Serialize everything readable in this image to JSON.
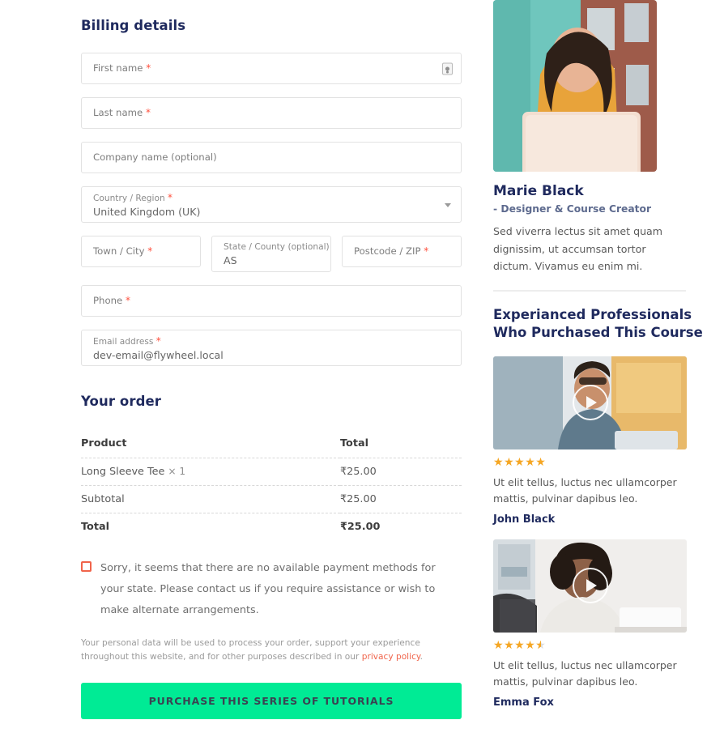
{
  "billing": {
    "title": "Billing details",
    "fields": [
      {
        "label": "First name",
        "required": true,
        "value": "",
        "icon": "autofill-contact-icon"
      },
      {
        "label": "Last name",
        "required": true,
        "value": ""
      },
      {
        "label": "Company name (optional)",
        "required": false,
        "value": ""
      },
      {
        "label": "Country / Region",
        "required": true,
        "value": "United Kingdom (UK)",
        "type": "select"
      },
      {
        "label": "Town / City",
        "required": true,
        "value": ""
      },
      {
        "label": "State / County (optional)",
        "required": false,
        "value": "AS"
      },
      {
        "label": "Postcode / ZIP",
        "required": true,
        "value": ""
      },
      {
        "label": "Phone",
        "required": true,
        "value": ""
      },
      {
        "label": "Email address",
        "required": true,
        "value": "dev-email@flywheel.local"
      }
    ]
  },
  "order": {
    "title": "Your order",
    "columns": [
      "Product",
      "Total"
    ],
    "rows": [
      {
        "product": "Long Sleeve Tee",
        "qty": "× 1",
        "total": "₹25.00"
      },
      {
        "product": "Subtotal",
        "qty": "",
        "total": "₹25.00"
      }
    ],
    "total_label": "Total",
    "total_value": "₹25.00"
  },
  "notice": {
    "text": "Sorry, it seems that there are no available payment methods for your state. Please contact us if you require assistance or wish to make alternate arrangements."
  },
  "privacy": {
    "before": "Your personal data will be used to process your order, support your experience throughout this website, and for other purposes described in our ",
    "link": "privacy policy",
    "after": "."
  },
  "purchase_button": {
    "label": "PURCHASE THIS SERIES OF TUTORIALS"
  },
  "author": {
    "name": "Marie Black",
    "role": "- Designer & Course Creator",
    "bio": "Sed viverra lectus sit amet quam dignissim, ut accumsan tortor dictum. Vivamus eu enim mi."
  },
  "testimonials_section": {
    "title": "Experianced Professionals Who Purchased This Course",
    "items": [
      {
        "rating": 5,
        "text": "Ut elit tellus, luctus nec ullamcorper mattis, pulvinar dapibus leo.",
        "author": "John Black"
      },
      {
        "rating": 4.5,
        "text": "Ut elit tellus, luctus nec ullamcorper mattis, pulvinar dapibus leo.",
        "author": "Emma Fox"
      }
    ]
  },
  "colors": {
    "heading": "#1f2a5e",
    "accent_green": "#00eb95",
    "accent_red": "#f0644b",
    "star": "#f5a623"
  }
}
